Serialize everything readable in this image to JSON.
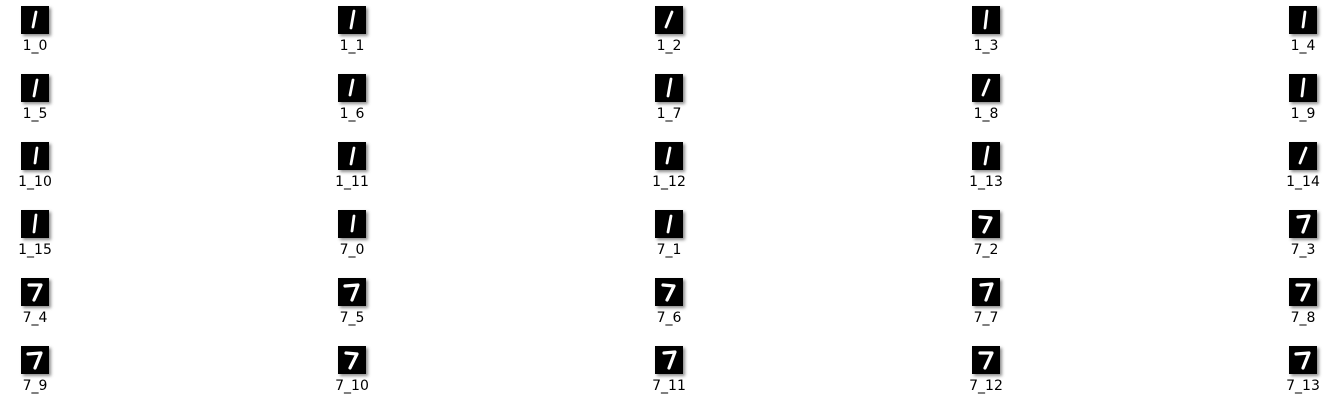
{
  "files": [
    {
      "name": "1_0",
      "digit": "1"
    },
    {
      "name": "1_1",
      "digit": "1"
    },
    {
      "name": "1_2",
      "digit": "1"
    },
    {
      "name": "1_3",
      "digit": "1"
    },
    {
      "name": "1_4",
      "digit": "1"
    },
    {
      "name": "1_5",
      "digit": "1"
    },
    {
      "name": "1_6",
      "digit": "1"
    },
    {
      "name": "1_7",
      "digit": "1"
    },
    {
      "name": "1_8",
      "digit": "1"
    },
    {
      "name": "1_9",
      "digit": "1"
    },
    {
      "name": "1_10",
      "digit": "1"
    },
    {
      "name": "1_11",
      "digit": "1"
    },
    {
      "name": "1_12",
      "digit": "1"
    },
    {
      "name": "1_13",
      "digit": "1"
    },
    {
      "name": "1_14",
      "digit": "1"
    },
    {
      "name": "1_15",
      "digit": "1"
    },
    {
      "name": "7_0",
      "digit": "1"
    },
    {
      "name": "7_1",
      "digit": "1"
    },
    {
      "name": "7_2",
      "digit": "7"
    },
    {
      "name": "7_3",
      "digit": "7"
    },
    {
      "name": "7_4",
      "digit": "7"
    },
    {
      "name": "7_5",
      "digit": "7"
    },
    {
      "name": "7_6",
      "digit": "7"
    },
    {
      "name": "7_7",
      "digit": "7"
    },
    {
      "name": "7_8",
      "digit": "7"
    },
    {
      "name": "7_9",
      "digit": "7"
    },
    {
      "name": "7_10",
      "digit": "7"
    },
    {
      "name": "7_11",
      "digit": "7"
    },
    {
      "name": "7_12",
      "digit": "7"
    },
    {
      "name": "7_13",
      "digit": "7"
    }
  ],
  "thumbnail_colors": {
    "background": "#000000",
    "stroke": "#ffffff"
  },
  "icon": "image-thumbnail-icon"
}
